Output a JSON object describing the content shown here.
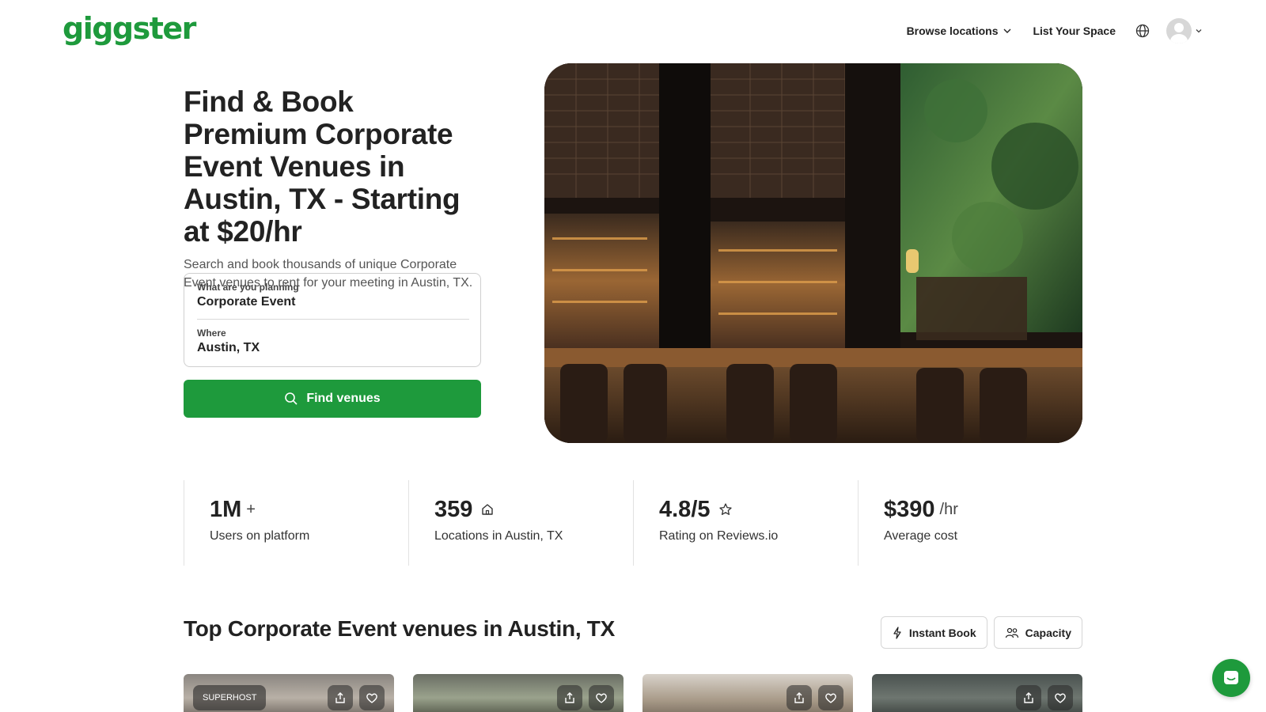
{
  "header": {
    "logo": "giggster",
    "nav": {
      "browse_label": "Browse locations",
      "list_label": "List Your Space"
    },
    "icons": {
      "chevron": "chevron-down-icon",
      "globe": "globe-icon",
      "avatar": "user-avatar-icon"
    }
  },
  "hero": {
    "title": "Find & Book Premium Corporate Event Venues in Austin, TX - Starting at $20/hr",
    "subtitle": "Search and book thousands of unique Corporate Event venues to rent for your meeting in Austin, TX.",
    "search": {
      "planning_label": "What are you planning",
      "planning_value": "Corporate Event",
      "where_label": "Where",
      "where_value": "Austin, TX"
    },
    "find_button": "Find venues"
  },
  "stats": [
    {
      "value": "1M",
      "suffix": "+",
      "label": "Users on platform"
    },
    {
      "value": "359",
      "icon": "home-icon",
      "label": "Locations in Austin, TX"
    },
    {
      "value": "4.8/5",
      "icon": "star-icon",
      "label": "Rating on Reviews.io"
    },
    {
      "value": "$390",
      "suffix": "/hr",
      "label": "Average cost"
    }
  ],
  "section": {
    "title": "Top Corporate Event venues in Austin, TX",
    "filters": {
      "instant_book": "Instant Book",
      "capacity": "Capacity"
    }
  },
  "cards": {
    "superhost_badge": "SUPERHOST"
  },
  "colors": {
    "brand": "#1e9a3c",
    "text": "#222222",
    "muted": "#555555"
  }
}
